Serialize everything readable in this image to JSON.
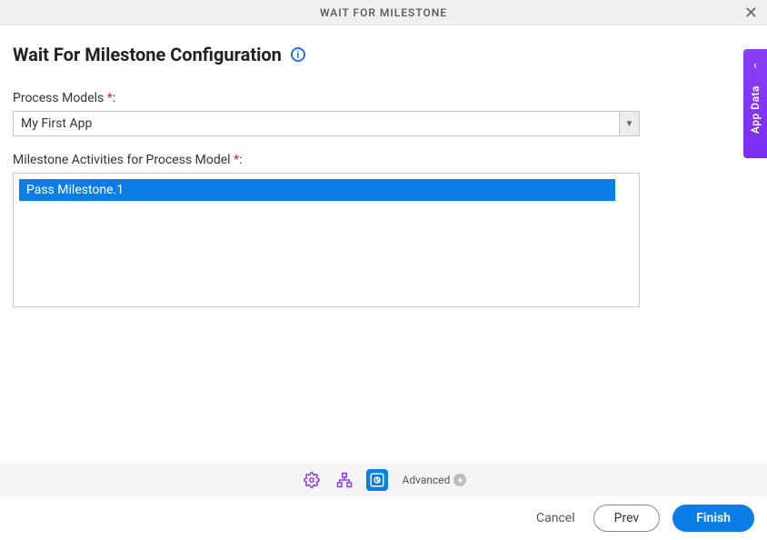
{
  "header": {
    "title": "WAIT FOR MILESTONE"
  },
  "page": {
    "title": "Wait For Milestone Configuration"
  },
  "fields": {
    "processModels": {
      "label": "Process Models",
      "value": "My First App"
    },
    "milestoneActivities": {
      "label": "Milestone Activities for Process Model",
      "items": [
        "Pass Milestone.1"
      ]
    }
  },
  "toolbar": {
    "advanced": "Advanced"
  },
  "footer": {
    "cancel": "Cancel",
    "prev": "Prev",
    "finish": "Finish"
  },
  "sidetab": {
    "label": "App Data"
  }
}
